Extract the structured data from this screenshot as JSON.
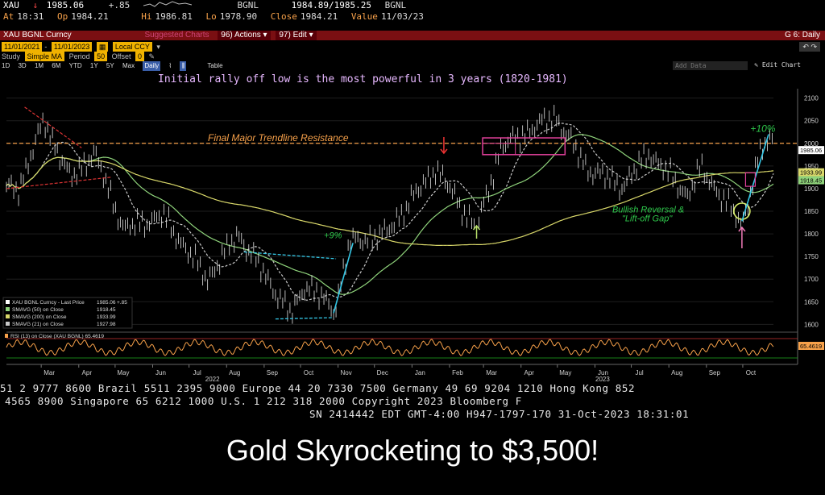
{
  "quote": {
    "ticker": "XAU",
    "arrow": "↓",
    "last": "1985.06",
    "change": "+.85",
    "source": "BGNL",
    "bid_ask": "1984.89/1985.25",
    "source2": "BGNL",
    "at_label": "At",
    "at_time": "18:31",
    "op_label": "Op",
    "op": "1984.21",
    "hi_label": "Hi",
    "hi": "1986.81",
    "lo_label": "Lo",
    "lo": "1978.90",
    "close_label": "Close",
    "close": "1984.21",
    "value_label": "Value",
    "value": "11/03/23"
  },
  "toolbar": {
    "security": "XAU BGNL Curncy",
    "suggested": "Suggested Charts",
    "actions": "96) Actions ▾",
    "edit": "97) Edit ▾",
    "chart_id": "G 6: Daily"
  },
  "controls": {
    "start_date": "11/01/2021",
    "end_date": "11/01/2023",
    "currency": "Local CCY",
    "study_label": "Study",
    "study": "Simple MA",
    "period_label": "Period",
    "period": "50",
    "offset_label": "Offset",
    "offset": "0",
    "ranges": [
      "1D",
      "3D",
      "1M",
      "6M",
      "YTD",
      "1Y",
      "5Y",
      "Max"
    ],
    "freq": "Daily",
    "table": "Table",
    "add_data": "Add Data",
    "edit_chart": "✎ Edit Chart"
  },
  "chart_data": {
    "type": "line",
    "title": "Initial rally off low is the most powerful in 3 years (1820-1981)",
    "xlabel": "",
    "ylabel": "",
    "ylim": [
      1590,
      2110
    ],
    "yticks": [
      1600,
      1650,
      1700,
      1750,
      1800,
      1850,
      1900,
      1950,
      2000,
      2050,
      2100
    ],
    "y_tick_labels": [
      "1600",
      "1650",
      "1700",
      "1750",
      "1800",
      "1850",
      "1900",
      "1950",
      "2000",
      "2050",
      "2100"
    ],
    "months": [
      "Mar",
      "Apr",
      "May",
      "Jun",
      "Jul",
      "Aug",
      "Sep",
      "Oct",
      "Nov",
      "Dec",
      "Jan",
      "Feb",
      "Mar",
      "Apr",
      "May",
      "Jun",
      "Jul",
      "Aug",
      "Sep",
      "Oct"
    ],
    "years": [
      "2022",
      "2023"
    ],
    "price_points": {
      "x": [
        "2022-02-15",
        "2022-03-08",
        "2022-03-30",
        "2022-04-18",
        "2022-05-13",
        "2022-06-14",
        "2022-07-21",
        "2022-08-15",
        "2022-09-28",
        "2022-10-10",
        "2022-11-03",
        "2022-11-15",
        "2022-12-15",
        "2023-01-25",
        "2023-02-28",
        "2023-03-20",
        "2023-04-13",
        "2023-05-04",
        "2023-05-30",
        "2023-06-29",
        "2023-07-20",
        "2023-08-21",
        "2023-09-01",
        "2023-10-05",
        "2023-10-20",
        "2023-10-27"
      ],
      "y": [
        1900,
        2050,
        1920,
        1980,
        1810,
        1840,
        1700,
        1800,
        1620,
        1690,
        1630,
        1780,
        1800,
        1945,
        1810,
        1990,
        2030,
        2060,
        1945,
        1905,
        1980,
        1885,
        1945,
        1820,
        1980,
        2005
      ]
    },
    "series": [
      {
        "name": "XAU BGNL Curncy - Last Price",
        "last": "1985.06",
        "change": "+.85",
        "color": "#ffffff"
      },
      {
        "name": "SMAVG (50) on Close",
        "last": "1918.45",
        "color": "#8fd37b"
      },
      {
        "name": "SMAVG (200) on Close",
        "last": "1933.99",
        "color": "#d9d86a"
      },
      {
        "name": "SMAVG (21) on Close",
        "last": "1927.98",
        "color": "#c8c8c8"
      }
    ],
    "rsi": {
      "name": "RSI (13) on Close (XAU BGNL)",
      "last": "65.4619",
      "color": "#f7a14a"
    },
    "annotations": {
      "resistance": "Final Major Trendline Resistance",
      "plus9": "+9%",
      "plus10": "+10%",
      "reversal1": "Bullish Reversal &",
      "reversal2": "\"Lift-off Gap\""
    },
    "price_labels": {
      "last": "1985.06",
      "ma200": "1933.99",
      "ma50": "1918.45"
    },
    "resistance_level": 2000,
    "colors": {
      "resistance": "#f7a14a",
      "annotation_text": "#e7b8ff",
      "green_text": "#2ec84b",
      "box": "#e0409a",
      "cyan": "#34c7e6"
    }
  },
  "footer": {
    "line1": "51 2 9777 8600 Brazil 5511 2395 9000 Europe 44 20 7330 7500 Germany 49 69 9204 1210 Hong Kong 852",
    "line2": "4565 8900        Singapore 65 6212 1000        U.S. 1 212 318 2000        Copyright 2023 Bloomberg F",
    "line3": "SN 2414442 EDT  GMT-4:00 H947-1797-170 31-Oct-2023 18:31:01"
  },
  "caption": "Gold Skyrocketing to $3,500!"
}
